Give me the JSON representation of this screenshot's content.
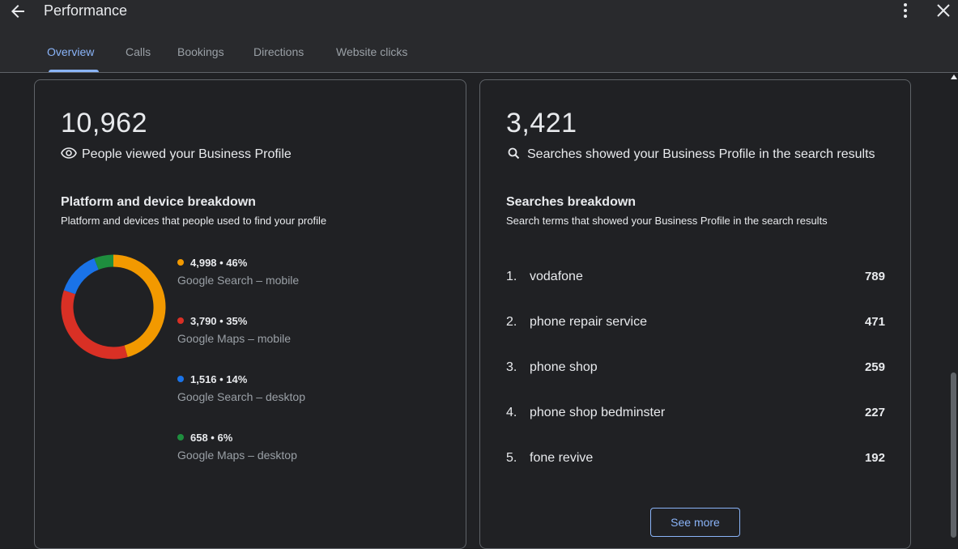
{
  "header": {
    "title": "Performance"
  },
  "tabs": [
    {
      "label": "Overview"
    },
    {
      "label": "Calls"
    },
    {
      "label": "Bookings"
    },
    {
      "label": "Directions"
    },
    {
      "label": "Website clicks"
    }
  ],
  "views_card": {
    "total": "10,962",
    "caption": "People viewed your Business Profile",
    "breakdown_title": "Platform and device breakdown",
    "breakdown_subtitle": "Platform and devices that people used to find your profile",
    "legend": [
      {
        "stat": "4,998 • 46%",
        "label": "Google Search – mobile",
        "color": "#f29900"
      },
      {
        "stat": "3,790 • 35%",
        "label": "Google Maps – mobile",
        "color": "#d93025"
      },
      {
        "stat": "1,516 • 14%",
        "label": "Google Search – desktop",
        "color": "#1a73e8"
      },
      {
        "stat": "658 • 6%",
        "label": "Google Maps – desktop",
        "color": "#1e8e3e"
      }
    ]
  },
  "chart_data": {
    "type": "pie",
    "categories": [
      "Google Search – mobile",
      "Google Maps – mobile",
      "Google Search – desktop",
      "Google Maps – desktop"
    ],
    "values": [
      4998,
      3790,
      1516,
      658
    ],
    "colors": [
      "#f29900",
      "#d93025",
      "#1a73e8",
      "#1e8e3e"
    ]
  },
  "searches_card": {
    "total": "3,421",
    "caption": "Searches showed your Business Profile in the search results",
    "breakdown_title": "Searches breakdown",
    "breakdown_subtitle": "Search terms that showed your Business Profile in the search results",
    "terms": [
      {
        "rank": "1.",
        "term": "vodafone",
        "count": "789"
      },
      {
        "rank": "2.",
        "term": "phone repair service",
        "count": "471"
      },
      {
        "rank": "3.",
        "term": "phone shop",
        "count": "259"
      },
      {
        "rank": "4.",
        "term": "phone shop bedminster",
        "count": "227"
      },
      {
        "rank": "5.",
        "term": "fone revive",
        "count": "192"
      }
    ],
    "see_more_label": "See more"
  }
}
